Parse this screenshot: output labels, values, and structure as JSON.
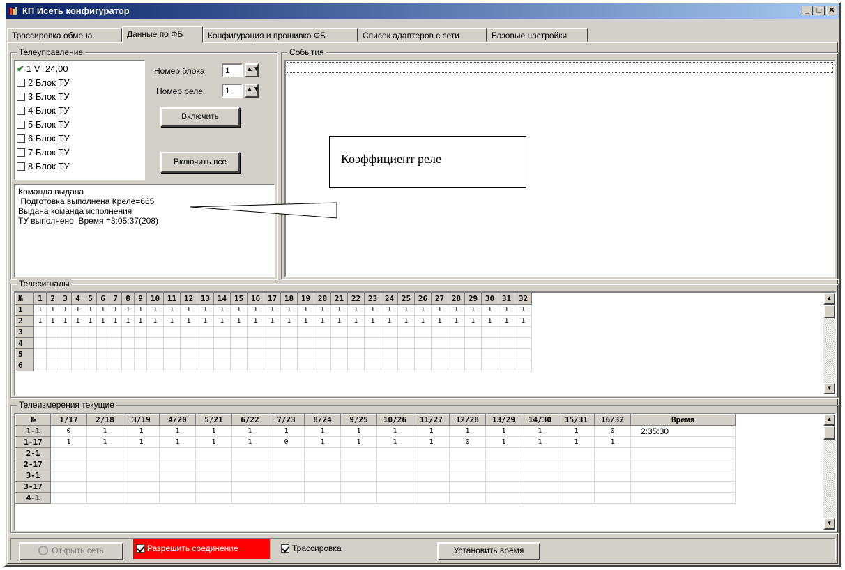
{
  "window": {
    "title": "КП Исеть конфигуратор"
  },
  "tabs": [
    "Трассировка обмена",
    "Данные по ФБ",
    "Конфигурация и прошивка ФБ",
    "Список адаптеров с сети",
    "Базовые настройки"
  ],
  "telecontrol": {
    "title": "Телеуправление",
    "items": [
      {
        "label": "1 V=24,00",
        "checked": true
      },
      {
        "label": "2 Блок ТУ",
        "checked": false
      },
      {
        "label": "3 Блок ТУ",
        "checked": false
      },
      {
        "label": "4 Блок ТУ",
        "checked": false
      },
      {
        "label": "5 Блок ТУ",
        "checked": false
      },
      {
        "label": "6 Блок ТУ",
        "checked": false
      },
      {
        "label": "7 Блок ТУ",
        "checked": false
      },
      {
        "label": "8 Блок ТУ",
        "checked": false
      }
    ],
    "block_label": "Номер блока",
    "block_value": "1",
    "relay_label": "Номер реле",
    "relay_value": "1",
    "on_button": "Включить",
    "on_all_button": "Включить все",
    "log": [
      "Команда выдана",
      " Подготовка выполнена Креле=665",
      "Выдана команда исполнения",
      "ТУ выполнено  Время =3:05:37(208)"
    ]
  },
  "events": {
    "title": "События"
  },
  "annotation": {
    "text": "Коэффициент реле"
  },
  "telesignals": {
    "title": "Телесигналы",
    "corner": "№",
    "columns": [
      "1",
      "2",
      "3",
      "4",
      "5",
      "6",
      "7",
      "8",
      "9",
      "10",
      "11",
      "12",
      "13",
      "14",
      "15",
      "16",
      "17",
      "18",
      "19",
      "20",
      "21",
      "22",
      "23",
      "24",
      "25",
      "26",
      "27",
      "28",
      "29",
      "30",
      "31",
      "32"
    ],
    "rows": [
      {
        "label": "1",
        "values": [
          "1",
          "1",
          "1",
          "1",
          "1",
          "1",
          "1",
          "1",
          "1",
          "1",
          "1",
          "1",
          "1",
          "1",
          "1",
          "1",
          "1",
          "1",
          "1",
          "1",
          "1",
          "1",
          "1",
          "1",
          "1",
          "1",
          "1",
          "1",
          "1",
          "1",
          "1",
          "1"
        ]
      },
      {
        "label": "2",
        "values": [
          "1",
          "1",
          "1",
          "1",
          "1",
          "1",
          "1",
          "1",
          "1",
          "1",
          "1",
          "1",
          "1",
          "1",
          "1",
          "1",
          "1",
          "1",
          "1",
          "1",
          "1",
          "1",
          "1",
          "1",
          "1",
          "1",
          "1",
          "1",
          "1",
          "1",
          "1",
          "1"
        ]
      },
      {
        "label": "3",
        "values": []
      },
      {
        "label": "4",
        "values": []
      },
      {
        "label": "5",
        "values": []
      },
      {
        "label": "6",
        "values": []
      }
    ]
  },
  "telemetry": {
    "title": "Телеизмерения текущие",
    "corner": "№",
    "columns": [
      "1/17",
      "2/18",
      "3/19",
      "4/20",
      "5/21",
      "6/22",
      "7/23",
      "8/24",
      "9/25",
      "10/26",
      "11/27",
      "12/28",
      "13/29",
      "14/30",
      "15/31",
      "16/32"
    ],
    "time_header": "Время",
    "rows": [
      {
        "label": "1-1",
        "values": [
          "0",
          "1",
          "1",
          "1",
          "1",
          "1",
          "1",
          "1",
          "1",
          "1",
          "1",
          "1",
          "1",
          "1",
          "1",
          "0"
        ],
        "time": "2:35:30"
      },
      {
        "label": "1-17",
        "values": [
          "1",
          "1",
          "1",
          "1",
          "1",
          "1",
          "0",
          "1",
          "1",
          "1",
          "1",
          "0",
          "1",
          "1",
          "1",
          "1"
        ],
        "time": ""
      },
      {
        "label": "2-1",
        "values": [],
        "time": ""
      },
      {
        "label": "2-17",
        "values": [],
        "time": ""
      },
      {
        "label": "3-1",
        "values": [],
        "time": ""
      },
      {
        "label": "3-17",
        "values": [],
        "time": ""
      },
      {
        "label": "4-1",
        "values": [],
        "time": ""
      }
    ]
  },
  "statusbar": {
    "open_network": "Открыть сеть",
    "allow_connection": "Разрешить соединение",
    "allow_connection_checked": true,
    "tracing": "Трассировка",
    "tracing_checked": true,
    "set_time": "Установить время"
  },
  "colors": {
    "allow_connection_bg": "#ff0000",
    "title_gradient_start": "#0a246a",
    "title_gradient_end": "#a6caf0"
  }
}
